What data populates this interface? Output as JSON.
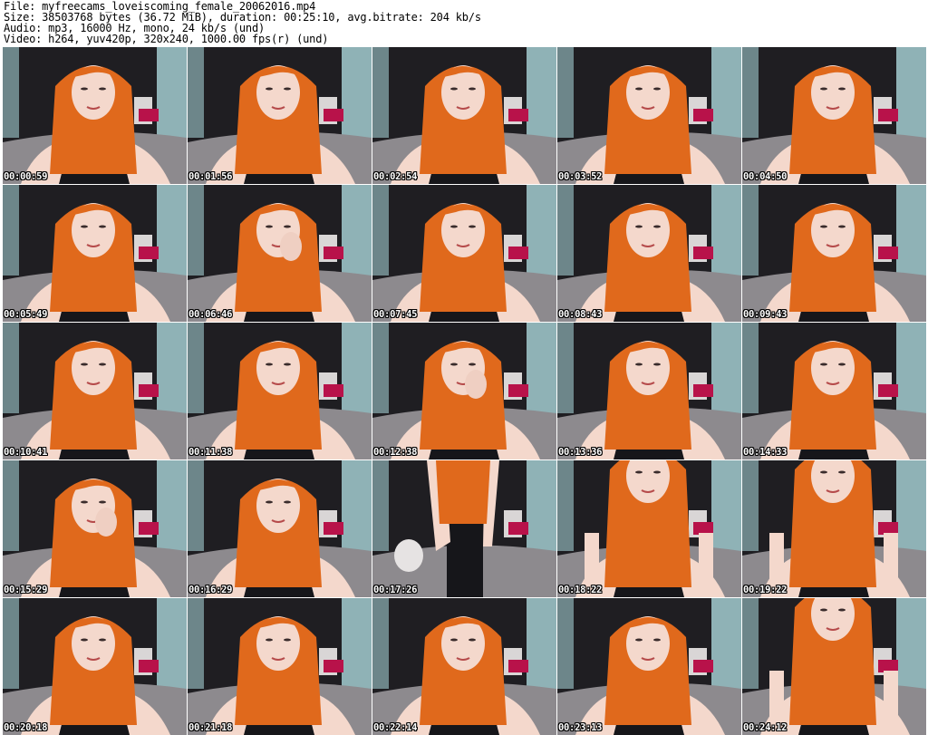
{
  "header": {
    "file": "File: myfreecams_loveiscoming_female_20062016.mp4",
    "size": "Size: 38503768 bytes (36.72 MiB), duration: 00:25:10, avg.bitrate: 204 kb/s",
    "audio": "Audio: mp3, 16000 Hz, mono, 24 kb/s (und)",
    "video": "Video: h264, yuv420p, 320x240, 1000.00 fps(r) (und)"
  },
  "thumbnails": [
    {
      "timestamp": "00:00:59",
      "pose": "center"
    },
    {
      "timestamp": "00:01:56",
      "pose": "center"
    },
    {
      "timestamp": "00:02:54",
      "pose": "center"
    },
    {
      "timestamp": "00:03:52",
      "pose": "center"
    },
    {
      "timestamp": "00:04:50",
      "pose": "center"
    },
    {
      "timestamp": "00:05:49",
      "pose": "center"
    },
    {
      "timestamp": "00:06:46",
      "pose": "hand"
    },
    {
      "timestamp": "00:07:45",
      "pose": "center"
    },
    {
      "timestamp": "00:08:43",
      "pose": "center"
    },
    {
      "timestamp": "00:09:43",
      "pose": "center"
    },
    {
      "timestamp": "00:10:41",
      "pose": "center"
    },
    {
      "timestamp": "00:11:38",
      "pose": "center"
    },
    {
      "timestamp": "00:12:38",
      "pose": "hand"
    },
    {
      "timestamp": "00:13:36",
      "pose": "center"
    },
    {
      "timestamp": "00:14:33",
      "pose": "center"
    },
    {
      "timestamp": "00:15:29",
      "pose": "hand"
    },
    {
      "timestamp": "00:16:29",
      "pose": "center"
    },
    {
      "timestamp": "00:17:26",
      "pose": "standing"
    },
    {
      "timestamp": "00:18:22",
      "pose": "leaning"
    },
    {
      "timestamp": "00:19:22",
      "pose": "leaning"
    },
    {
      "timestamp": "00:20:18",
      "pose": "center"
    },
    {
      "timestamp": "00:21:18",
      "pose": "center"
    },
    {
      "timestamp": "00:22:14",
      "pose": "center"
    },
    {
      "timestamp": "00:23:13",
      "pose": "center"
    },
    {
      "timestamp": "00:24:12",
      "pose": "leaning"
    }
  ],
  "colors": {
    "hair": "#e0691c",
    "skin": "#f4d8cc",
    "background_dark": "#1f1e22",
    "wall": "#8fb2b6",
    "bed": "#8d8a8e",
    "top": "#16161a"
  }
}
